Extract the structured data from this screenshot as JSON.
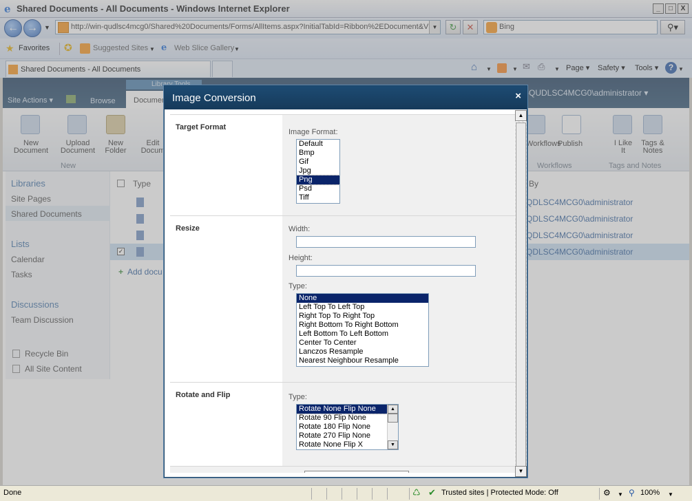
{
  "window": {
    "title": "Shared Documents - All Documents - Windows Internet Explorer",
    "minimize": "_",
    "maximize": "□",
    "close": "X"
  },
  "addressbar": {
    "url": "http://win-qudlsc4mcg0/Shared%20Documents/Forms/AllItems.aspx?InitialTabId=Ribbon%2EDocument&Vis",
    "search_placeholder": "Bing"
  },
  "favorites": {
    "label": "Favorites",
    "suggested": "Suggested Sites",
    "webslice": "Web Slice Gallery"
  },
  "tab": {
    "label": "Shared Documents - All Documents"
  },
  "commandbar": {
    "page": "Page",
    "safety": "Safety",
    "tools": "Tools"
  },
  "sharepoint": {
    "site_actions": "Site Actions",
    "browse": "Browse",
    "documents_tab": "Documen",
    "library_tools": "Library Tools",
    "user": "-QUDLSC4MCG0\\administrator",
    "ribbon": {
      "new_document": "New Document",
      "upload_document": "Upload Document",
      "new_folder": "New Folder",
      "edit_document": "Edit Docum",
      "group_new": "New",
      "workflows": "Workflows",
      "publish": "Publish",
      "group_workflows": "Workflows",
      "i_like_it": "I Like It",
      "tags_notes": "Tags & Notes",
      "group_tags": "Tags and Notes"
    },
    "quicklaunch": {
      "libraries": "Libraries",
      "site_pages": "Site Pages",
      "shared_documents": "Shared Documents",
      "lists": "Lists",
      "calendar": "Calendar",
      "tasks": "Tasks",
      "discussions": "Discussions",
      "team_discussion": "Team Discussion",
      "recycle_bin": "Recycle Bin",
      "all_site_content": "All Site Content"
    },
    "list": {
      "col_type": "Type",
      "col_by": "By",
      "rows": [
        "QDLSC4MCG0\\administrator",
        "QDLSC4MCG0\\administrator",
        "QDLSC4MCG0\\administrator",
        "QDLSC4MCG0\\administrator"
      ],
      "add_document": "Add docu"
    }
  },
  "dialog": {
    "title": "Image Conversion",
    "close": "×",
    "target_format": {
      "section": "Target Format",
      "label": "Image Format:",
      "options": [
        "Default",
        "Bmp",
        "Gif",
        "Jpg",
        "Png",
        "Psd",
        "Tiff"
      ],
      "selected": "Png"
    },
    "resize": {
      "section": "Resize",
      "width_label": "Width:",
      "width_value": "",
      "height_label": "Height:",
      "height_value": "",
      "type_label": "Type:",
      "options": [
        "None",
        "Left Top To Left Top",
        "Right Top To Right Top",
        "Right Bottom To Right Bottom",
        "Left Bottom To Left Bottom",
        "Center To Center",
        "Lanczos Resample",
        "Nearest Neighbour Resample"
      ],
      "selected": "None"
    },
    "rotate": {
      "section": "Rotate and Flip",
      "type_label": "Type:",
      "options": [
        "Rotate None Flip None",
        "Rotate 90 Flip None",
        "Rotate 180 Flip None",
        "Rotate 270 Flip None",
        "Rotate None Flip X"
      ],
      "selected": "Rotate None Flip None"
    }
  },
  "statusbar": {
    "status": "Done",
    "zone": "Trusted sites | Protected Mode: Off",
    "zoom": "100%"
  }
}
